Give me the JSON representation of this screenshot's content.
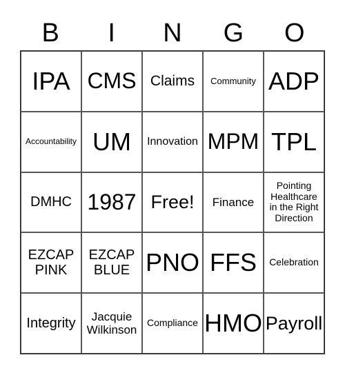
{
  "header": {
    "letters": [
      "B",
      "I",
      "N",
      "G",
      "O"
    ]
  },
  "cells": [
    [
      "IPA",
      "CMS",
      "Claims",
      "Community",
      "ADP"
    ],
    [
      "Accountability",
      "UM",
      "Innovation",
      "MPM",
      "TPL"
    ],
    [
      "DMHC",
      "1987",
      "Free!",
      "Finance",
      "Pointing Healthcare in the Right Direction"
    ],
    [
      "EZCAP PINK",
      "EZCAP BLUE",
      "PNO",
      "FFS",
      "Celebration"
    ],
    [
      "Integrity",
      "Jacquie Wilkinson",
      "Compliance",
      "HMO",
      "Payroll"
    ]
  ]
}
